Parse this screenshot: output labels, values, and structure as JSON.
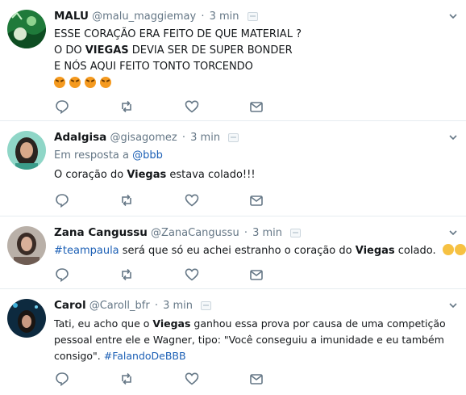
{
  "tweets": [
    {
      "name": "MALU",
      "handle": "@malu_maggiemay",
      "time": "3 min",
      "lines": [
        "ESSE CORAÇÃO ERA FEITO DE QUE MATERIAL ?",
        "O DO ",
        "VIEGAS",
        " DEVIA SER DE SUPER BONDER",
        "E NÓS AQUI FEITO TONTO  TORCENDO"
      ],
      "emoji_count": 4
    },
    {
      "name": "Adalgisa",
      "handle": "@gisagomez",
      "time": "3 min",
      "reply_prefix": "Em resposta a ",
      "reply_handle": "@bbb",
      "text_before": "O coração do ",
      "bold": "Viegas",
      "text_after": " estava colado!!!"
    },
    {
      "name": "Zana Cangussu",
      "handle": "@ZanaCangussu",
      "time": "3 min",
      "hashtag": "#teampaula",
      "text_before": " será que só eu achei estranho o coração do ",
      "bold": "Viegas",
      "text_after": " colado."
    },
    {
      "name": "Carol",
      "handle": "@Caroll_bfr",
      "time": "3 min",
      "text_before": "Tati, eu acho que o ",
      "bold": "Viegas",
      "line1_after": " ganhou essa prova por causa de uma competição",
      "line2": "pessoal entre ele e Wagner, tipo: \"Você conseguiu a imunidade e eu também",
      "line3_before": "consigo\". ",
      "hashtag": "#FalandoDeBBB"
    }
  ],
  "colors": {
    "icon": "#657786",
    "link": "#1b5fb5",
    "divider": "#e6ecf0"
  },
  "icons": [
    "reply-icon",
    "retweet-icon",
    "like-icon",
    "dm-icon",
    "chevron-down-icon",
    "translate-icon"
  ],
  "separator": "·"
}
